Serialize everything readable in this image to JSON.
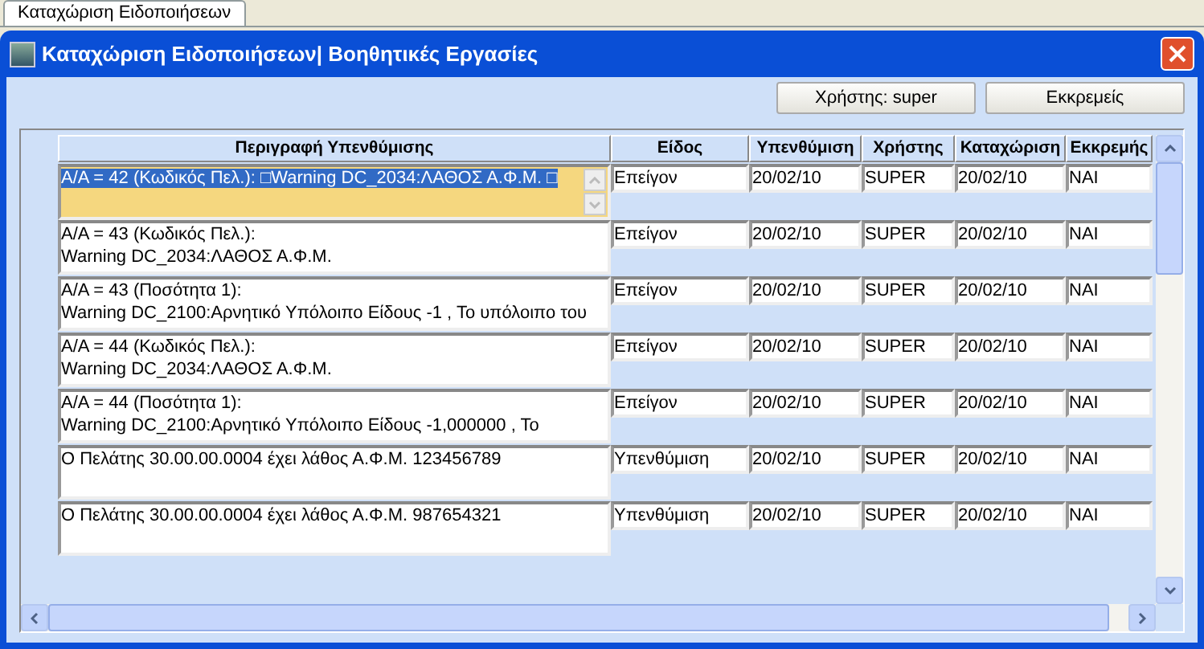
{
  "tab": {
    "label": "Καταχώριση Ειδοποιήσεων",
    "selected": true
  },
  "window": {
    "title": "Καταχώριση Ειδοποιήσεων| Βοηθητικές Εργασίες"
  },
  "buttons": [
    "Χρήστης: super",
    "Εκκρεμείς"
  ],
  "table": {
    "columns": [
      "Περιγραφή Υπενθύμισης",
      "Είδος",
      "Υπενθύμιση",
      "Χρήστης",
      "Καταχώριση",
      "Εκκρεμής"
    ],
    "rows": [
      {
        "selected": true,
        "cells": [
          "A/A = 42 (Κωδικός Πελ.): □Warning DC_2034:ΛΑΘΟΣ Α.Φ.Μ. □",
          "Επείγον",
          "20/02/10",
          "SUPER",
          "20/02/10",
          "NAI"
        ]
      },
      {
        "selected": false,
        "cells": [
          "A/A = 43 (Κωδικός Πελ.):\nWarning DC_2034:ΛΑΘΟΣ Α.Φ.Μ.",
          "Επείγον",
          "20/02/10",
          "SUPER",
          "20/02/10",
          "NAI"
        ]
      },
      {
        "selected": false,
        "cells": [
          "A/A = 43 (Ποσότητα 1):\nWarning DC_2100:Αρνητικό Υπόλοιπο Είδους -1 , Το υπόλοιπο του",
          "Επείγον",
          "20/02/10",
          "SUPER",
          "20/02/10",
          "NAI"
        ]
      },
      {
        "selected": false,
        "cells": [
          "A/A = 44 (Κωδικός Πελ.):\nWarning DC_2034:ΛΑΘΟΣ Α.Φ.Μ.",
          "Επείγον",
          "20/02/10",
          "SUPER",
          "20/02/10",
          "NAI"
        ]
      },
      {
        "selected": false,
        "cells": [
          "A/A = 44 (Ποσότητα 1):\nWarning DC_2100:Αρνητικό Υπόλοιπο Είδους -1,000000 , Το",
          "Επείγον",
          "20/02/10",
          "SUPER",
          "20/02/10",
          "NAI"
        ]
      },
      {
        "selected": false,
        "cells": [
          "Ο Πελάτης 30.00.00.0004 έχει λάθος Α.Φ.Μ. 123456789",
          "Υπενθύμιση",
          "20/02/10",
          "SUPER",
          "20/02/10",
          "NAI"
        ]
      },
      {
        "selected": false,
        "cells": [
          "Ο Πελάτης 30.00.00.0004 έχει λάθος Α.Φ.Μ. 987654321",
          "Υπενθύμιση",
          "20/02/10",
          "SUPER",
          "20/02/10",
          "NAI"
        ]
      }
    ]
  }
}
